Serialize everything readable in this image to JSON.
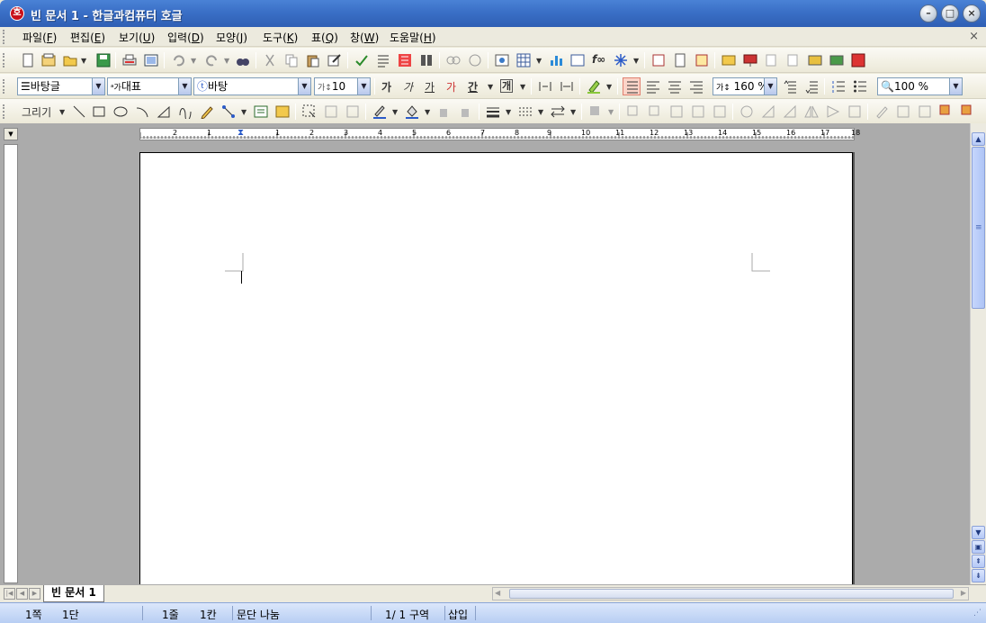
{
  "window": {
    "title": "빈 문서 1 - 한글과컴퓨터 호글",
    "app_icon": "호"
  },
  "menubar": {
    "items": [
      {
        "label": "파일(",
        "key": "F"
      },
      {
        "label": "편집(",
        "key": "E"
      },
      {
        "label": "보기(",
        "key": "U"
      },
      {
        "label": "입력(",
        "key": "D"
      },
      {
        "label": "모양(",
        "key": "J"
      },
      {
        "label": "도구(",
        "key": "K"
      },
      {
        "label": "표(",
        "key": "Q"
      },
      {
        "label": "창(",
        "key": "W"
      },
      {
        "label": "도움말(",
        "key": "H"
      }
    ],
    "close_glyph": "×"
  },
  "format_toolbar": {
    "style": "바탕글",
    "language": "대표",
    "font": "바탕",
    "size": "10",
    "bold": "가",
    "italic": "가",
    "underline": "가",
    "strike": "가",
    "char_shape": "간",
    "border": "개",
    "line_spacing": "160 %",
    "zoom": "100 %"
  },
  "draw_toolbar": {
    "label": "그리기"
  },
  "ruler": {
    "h_numbers": [
      "2",
      "1",
      "1",
      "2",
      "3",
      "4",
      "5",
      "6",
      "7",
      "8",
      "9",
      "10",
      "11",
      "12",
      "13",
      "14",
      "15",
      "16",
      "17",
      "18"
    ]
  },
  "tabs": {
    "document_tab": "빈 문서 1"
  },
  "status": {
    "page": "1쪽",
    "column": "1단",
    "line": "1줄",
    "char": "1칸",
    "para_break": "문단 나눔",
    "section": "1/  1 구역",
    "mode": "삽입"
  },
  "colors": {
    "title_bar": "#3a6fc6",
    "workspace": "#ababab",
    "status_bar": "#c6d8f6"
  }
}
